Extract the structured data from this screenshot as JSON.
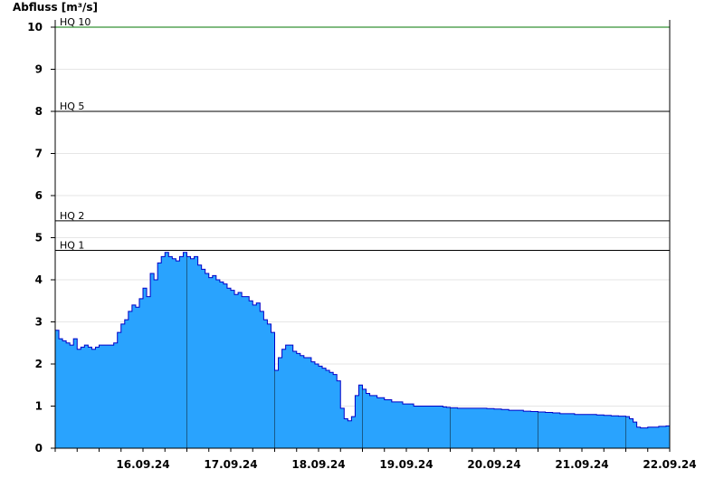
{
  "chart_data": {
    "type": "area",
    "ylabel": "Abfluss [m³/s]",
    "ylim": [
      0,
      10
    ],
    "yticks": [
      0,
      1,
      2,
      3,
      4,
      5,
      6,
      7,
      8,
      9,
      10
    ],
    "xlim": [
      "2024-09-15T12:00",
      "2024-09-22T12:00"
    ],
    "day_ticks": [
      "2024-09-16",
      "2024-09-17",
      "2024-09-18",
      "2024-09-19",
      "2024-09-20",
      "2024-09-21",
      "2024-09-22"
    ],
    "date_labels": [
      "16.09.24",
      "17.09.24",
      "18.09.24",
      "19.09.24",
      "20.09.24",
      "21.09.24",
      "22.09.24"
    ],
    "grid": true,
    "colors": {
      "fill": "#29a3fe",
      "line": "#0000c8",
      "hq10": "#007700",
      "hq": "#000000"
    },
    "thresholds": [
      {
        "label": "HQ 10",
        "value": 10.0,
        "color": "#007700"
      },
      {
        "label": "HQ 5",
        "value": 8.0,
        "color": "#000000"
      },
      {
        "label": "HQ 2",
        "value": 5.4,
        "color": "#000000"
      },
      {
        "label": "HQ 1",
        "value": 4.7,
        "color": "#000000"
      }
    ],
    "series": [
      {
        "x": [
          "2024-09-15T12:00",
          "2024-09-15T13:00",
          "2024-09-15T14:00",
          "2024-09-15T15:00",
          "2024-09-15T16:00",
          "2024-09-15T17:00",
          "2024-09-15T18:00",
          "2024-09-15T19:00",
          "2024-09-15T20:00",
          "2024-09-15T21:00",
          "2024-09-15T22:00",
          "2024-09-15T23:00",
          "2024-09-16T00:00",
          "2024-09-16T01:00",
          "2024-09-16T02:00",
          "2024-09-16T03:00",
          "2024-09-16T04:00",
          "2024-09-16T05:00",
          "2024-09-16T06:00",
          "2024-09-16T07:00",
          "2024-09-16T08:00",
          "2024-09-16T09:00",
          "2024-09-16T10:00",
          "2024-09-16T11:00",
          "2024-09-16T12:00",
          "2024-09-16T13:00",
          "2024-09-16T14:00",
          "2024-09-16T15:00",
          "2024-09-16T16:00",
          "2024-09-16T17:00",
          "2024-09-16T18:00",
          "2024-09-16T19:00",
          "2024-09-16T20:00",
          "2024-09-16T21:00",
          "2024-09-16T22:00",
          "2024-09-16T23:00",
          "2024-09-17T00:00",
          "2024-09-17T01:00",
          "2024-09-17T02:00",
          "2024-09-17T03:00",
          "2024-09-17T04:00",
          "2024-09-17T05:00",
          "2024-09-17T06:00",
          "2024-09-17T07:00",
          "2024-09-17T08:00",
          "2024-09-17T09:00",
          "2024-09-17T10:00",
          "2024-09-17T11:00",
          "2024-09-17T12:00",
          "2024-09-17T13:00",
          "2024-09-17T14:00",
          "2024-09-17T15:00",
          "2024-09-17T16:00",
          "2024-09-17T17:00",
          "2024-09-17T18:00",
          "2024-09-17T19:00",
          "2024-09-17T20:00",
          "2024-09-17T21:00",
          "2024-09-17T22:00",
          "2024-09-17T23:00",
          "2024-09-18T00:00",
          "2024-09-18T01:00",
          "2024-09-18T02:00",
          "2024-09-18T03:00",
          "2024-09-18T04:00",
          "2024-09-18T05:00",
          "2024-09-18T06:00",
          "2024-09-18T07:00",
          "2024-09-18T08:00",
          "2024-09-18T09:00",
          "2024-09-18T10:00",
          "2024-09-18T11:00",
          "2024-09-18T12:00",
          "2024-09-18T13:00",
          "2024-09-18T14:00",
          "2024-09-18T15:00",
          "2024-09-18T16:00",
          "2024-09-18T17:00",
          "2024-09-18T18:00",
          "2024-09-18T19:00",
          "2024-09-18T20:00",
          "2024-09-18T21:00",
          "2024-09-18T22:00",
          "2024-09-18T23:00",
          "2024-09-19T00:00",
          "2024-09-19T01:00",
          "2024-09-19T02:00",
          "2024-09-19T03:00",
          "2024-09-19T04:00",
          "2024-09-19T05:00",
          "2024-09-19T06:00",
          "2024-09-19T07:00",
          "2024-09-19T08:00",
          "2024-09-19T09:00",
          "2024-09-19T10:00",
          "2024-09-19T11:00",
          "2024-09-19T12:00",
          "2024-09-19T13:00",
          "2024-09-19T14:00",
          "2024-09-19T15:00",
          "2024-09-19T16:00",
          "2024-09-19T17:00",
          "2024-09-19T18:00",
          "2024-09-19T19:00",
          "2024-09-19T20:00",
          "2024-09-19T21:00",
          "2024-09-19T22:00",
          "2024-09-19T23:00",
          "2024-09-20T00:00",
          "2024-09-20T02:00",
          "2024-09-20T04:00",
          "2024-09-20T06:00",
          "2024-09-20T08:00",
          "2024-09-20T10:00",
          "2024-09-20T12:00",
          "2024-09-20T14:00",
          "2024-09-20T16:00",
          "2024-09-20T18:00",
          "2024-09-20T20:00",
          "2024-09-20T22:00",
          "2024-09-21T00:00",
          "2024-09-21T02:00",
          "2024-09-21T04:00",
          "2024-09-21T06:00",
          "2024-09-21T08:00",
          "2024-09-21T10:00",
          "2024-09-21T12:00",
          "2024-09-21T14:00",
          "2024-09-21T16:00",
          "2024-09-21T18:00",
          "2024-09-21T20:00",
          "2024-09-21T22:00",
          "2024-09-22T00:00",
          "2024-09-22T01:00",
          "2024-09-22T02:00",
          "2024-09-22T03:00",
          "2024-09-22T04:00",
          "2024-09-22T05:00",
          "2024-09-22T06:00",
          "2024-09-22T07:00",
          "2024-09-22T08:00",
          "2024-09-22T09:00",
          "2024-09-22T10:00",
          "2024-09-22T11:00",
          "2024-09-22T12:00"
        ],
        "values": [
          2.8,
          2.6,
          2.55,
          2.5,
          2.45,
          2.6,
          2.35,
          2.4,
          2.45,
          2.4,
          2.35,
          2.4,
          2.45,
          2.45,
          2.45,
          2.45,
          2.5,
          2.75,
          2.95,
          3.05,
          3.25,
          3.4,
          3.35,
          3.55,
          3.8,
          3.6,
          4.15,
          4.0,
          4.4,
          4.55,
          4.65,
          4.55,
          4.5,
          4.45,
          4.55,
          4.65,
          4.55,
          4.5,
          4.55,
          4.35,
          4.25,
          4.15,
          4.05,
          4.1,
          4.0,
          3.95,
          3.9,
          3.8,
          3.75,
          3.65,
          3.7,
          3.6,
          3.6,
          3.5,
          3.4,
          3.45,
          3.25,
          3.05,
          2.95,
          2.75,
          1.85,
          2.15,
          2.35,
          2.45,
          2.45,
          2.3,
          2.25,
          2.2,
          2.15,
          2.15,
          2.05,
          2.0,
          1.95,
          1.9,
          1.85,
          1.8,
          1.75,
          1.6,
          0.95,
          0.7,
          0.65,
          0.75,
          1.25,
          1.5,
          1.4,
          1.3,
          1.25,
          1.25,
          1.2,
          1.2,
          1.15,
          1.15,
          1.1,
          1.1,
          1.1,
          1.05,
          1.05,
          1.05,
          1.0,
          1.0,
          1.0,
          1.0,
          1.0,
          1.0,
          1.0,
          1.0,
          0.98,
          0.97,
          0.96,
          0.95,
          0.95,
          0.95,
          0.95,
          0.94,
          0.93,
          0.92,
          0.9,
          0.9,
          0.88,
          0.87,
          0.86,
          0.85,
          0.84,
          0.82,
          0.82,
          0.8,
          0.8,
          0.8,
          0.79,
          0.78,
          0.77,
          0.76,
          0.75,
          0.7,
          0.62,
          0.5,
          0.48,
          0.48,
          0.5,
          0.5,
          0.5,
          0.52,
          0.52,
          0.53,
          0.53
        ]
      }
    ]
  }
}
